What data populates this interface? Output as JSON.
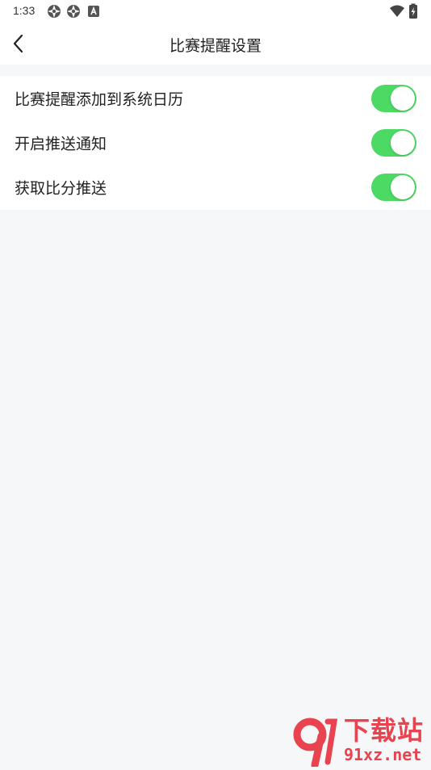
{
  "status_bar": {
    "time": "1:33",
    "icons": [
      "aperture-icon",
      "aperture-icon",
      "font-app-icon",
      "wifi-icon",
      "battery-charging-icon"
    ]
  },
  "header": {
    "back_icon": "chevron-left-icon",
    "title": "比赛提醒设置"
  },
  "settings": {
    "items": [
      {
        "label": "比赛提醒添加到系统日历",
        "enabled": true
      },
      {
        "label": "开启推送通知",
        "enabled": true
      },
      {
        "label": "获取比分推送",
        "enabled": true
      }
    ]
  },
  "watermark": {
    "line1": "下载站",
    "line2": "91xz.net"
  },
  "colors": {
    "toggle_on": "#4cd964",
    "background": "#f6f7f9",
    "surface": "#ffffff",
    "watermark": "#e8434e"
  }
}
